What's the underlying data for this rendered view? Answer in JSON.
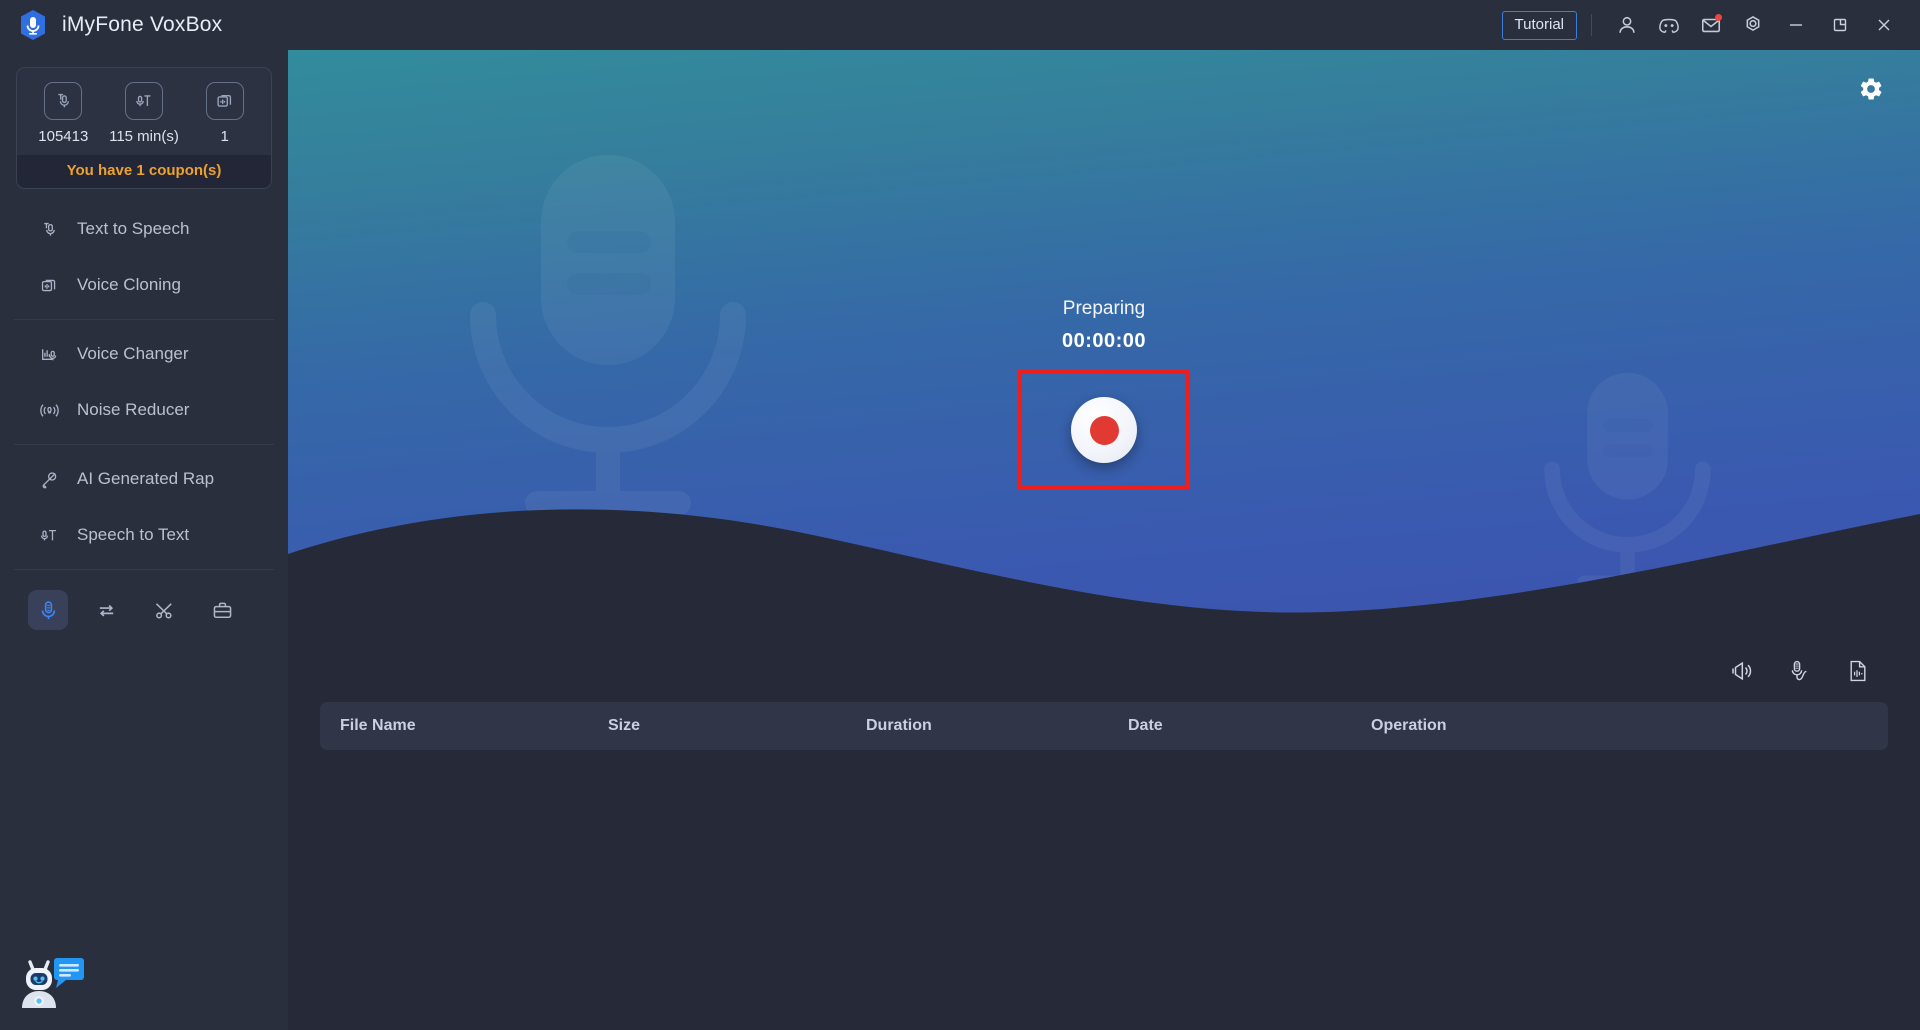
{
  "window": {
    "title": "iMyFone VoxBox",
    "logo_icon": "voxbox-mic-logo"
  },
  "titlebar": {
    "tutorial_label": "Tutorial",
    "icons": [
      {
        "name": "account-icon",
        "glyph": "user"
      },
      {
        "name": "discord-icon",
        "glyph": "discord"
      },
      {
        "name": "mail-icon",
        "glyph": "mail",
        "badge": true
      },
      {
        "name": "settings-icon",
        "glyph": "gear-hex"
      }
    ],
    "window_controls": [
      {
        "name": "minimize-button",
        "glyph": "minimize"
      },
      {
        "name": "maximize-button",
        "glyph": "maximize"
      },
      {
        "name": "close-button",
        "glyph": "close"
      }
    ]
  },
  "sidebar": {
    "credits": [
      {
        "icon": "text-to-speech-credit-icon",
        "value": "105413"
      },
      {
        "icon": "speech-to-text-credit-icon",
        "value": "115 min(s)"
      },
      {
        "icon": "voice-cloning-credit-icon",
        "value": "1"
      }
    ],
    "coupon_text": "You have 1 coupon(s)",
    "nav_groups": [
      {
        "items": [
          {
            "label": "Text to Speech",
            "icon": "text-to-speech-icon"
          },
          {
            "label": "Voice Cloning",
            "icon": "voice-cloning-icon"
          }
        ]
      },
      {
        "items": [
          {
            "label": "Voice Changer",
            "icon": "voice-changer-icon"
          },
          {
            "label": "Noise Reducer",
            "icon": "noise-reducer-icon"
          }
        ]
      },
      {
        "items": [
          {
            "label": "AI Generated Rap",
            "icon": "ai-rap-icon"
          },
          {
            "label": "Speech to Text",
            "icon": "speech-to-text-icon"
          }
        ]
      }
    ],
    "tools": [
      {
        "name": "recorder-tool",
        "icon": "microphone-icon",
        "active": true
      },
      {
        "name": "converter-tool",
        "icon": "convert-loop-icon",
        "active": false
      },
      {
        "name": "cutter-tool",
        "icon": "scissors-icon",
        "active": false
      },
      {
        "name": "toolbox-tool",
        "icon": "toolbox-icon",
        "active": false
      }
    ],
    "assistant_icon": "chatbot-assistant-icon"
  },
  "hero": {
    "settings_icon": "gear-icon",
    "status": "Preparing",
    "timer": "00:00:00",
    "record_button": "record-button",
    "highlight_color": "#f01d1d",
    "gradient_top": "#328c9c",
    "gradient_bottom": "#3d53ae",
    "watermark_icon": "microphone-watermark"
  },
  "file_panel": {
    "actions": [
      {
        "name": "system-sound-icon",
        "glyph": "speaker"
      },
      {
        "name": "microphone-input-icon",
        "glyph": "mic-wave"
      },
      {
        "name": "audio-file-icon",
        "glyph": "file-audio"
      }
    ],
    "columns": [
      "File Name",
      "Size",
      "Duration",
      "Date",
      "Operation"
    ],
    "rows": []
  }
}
